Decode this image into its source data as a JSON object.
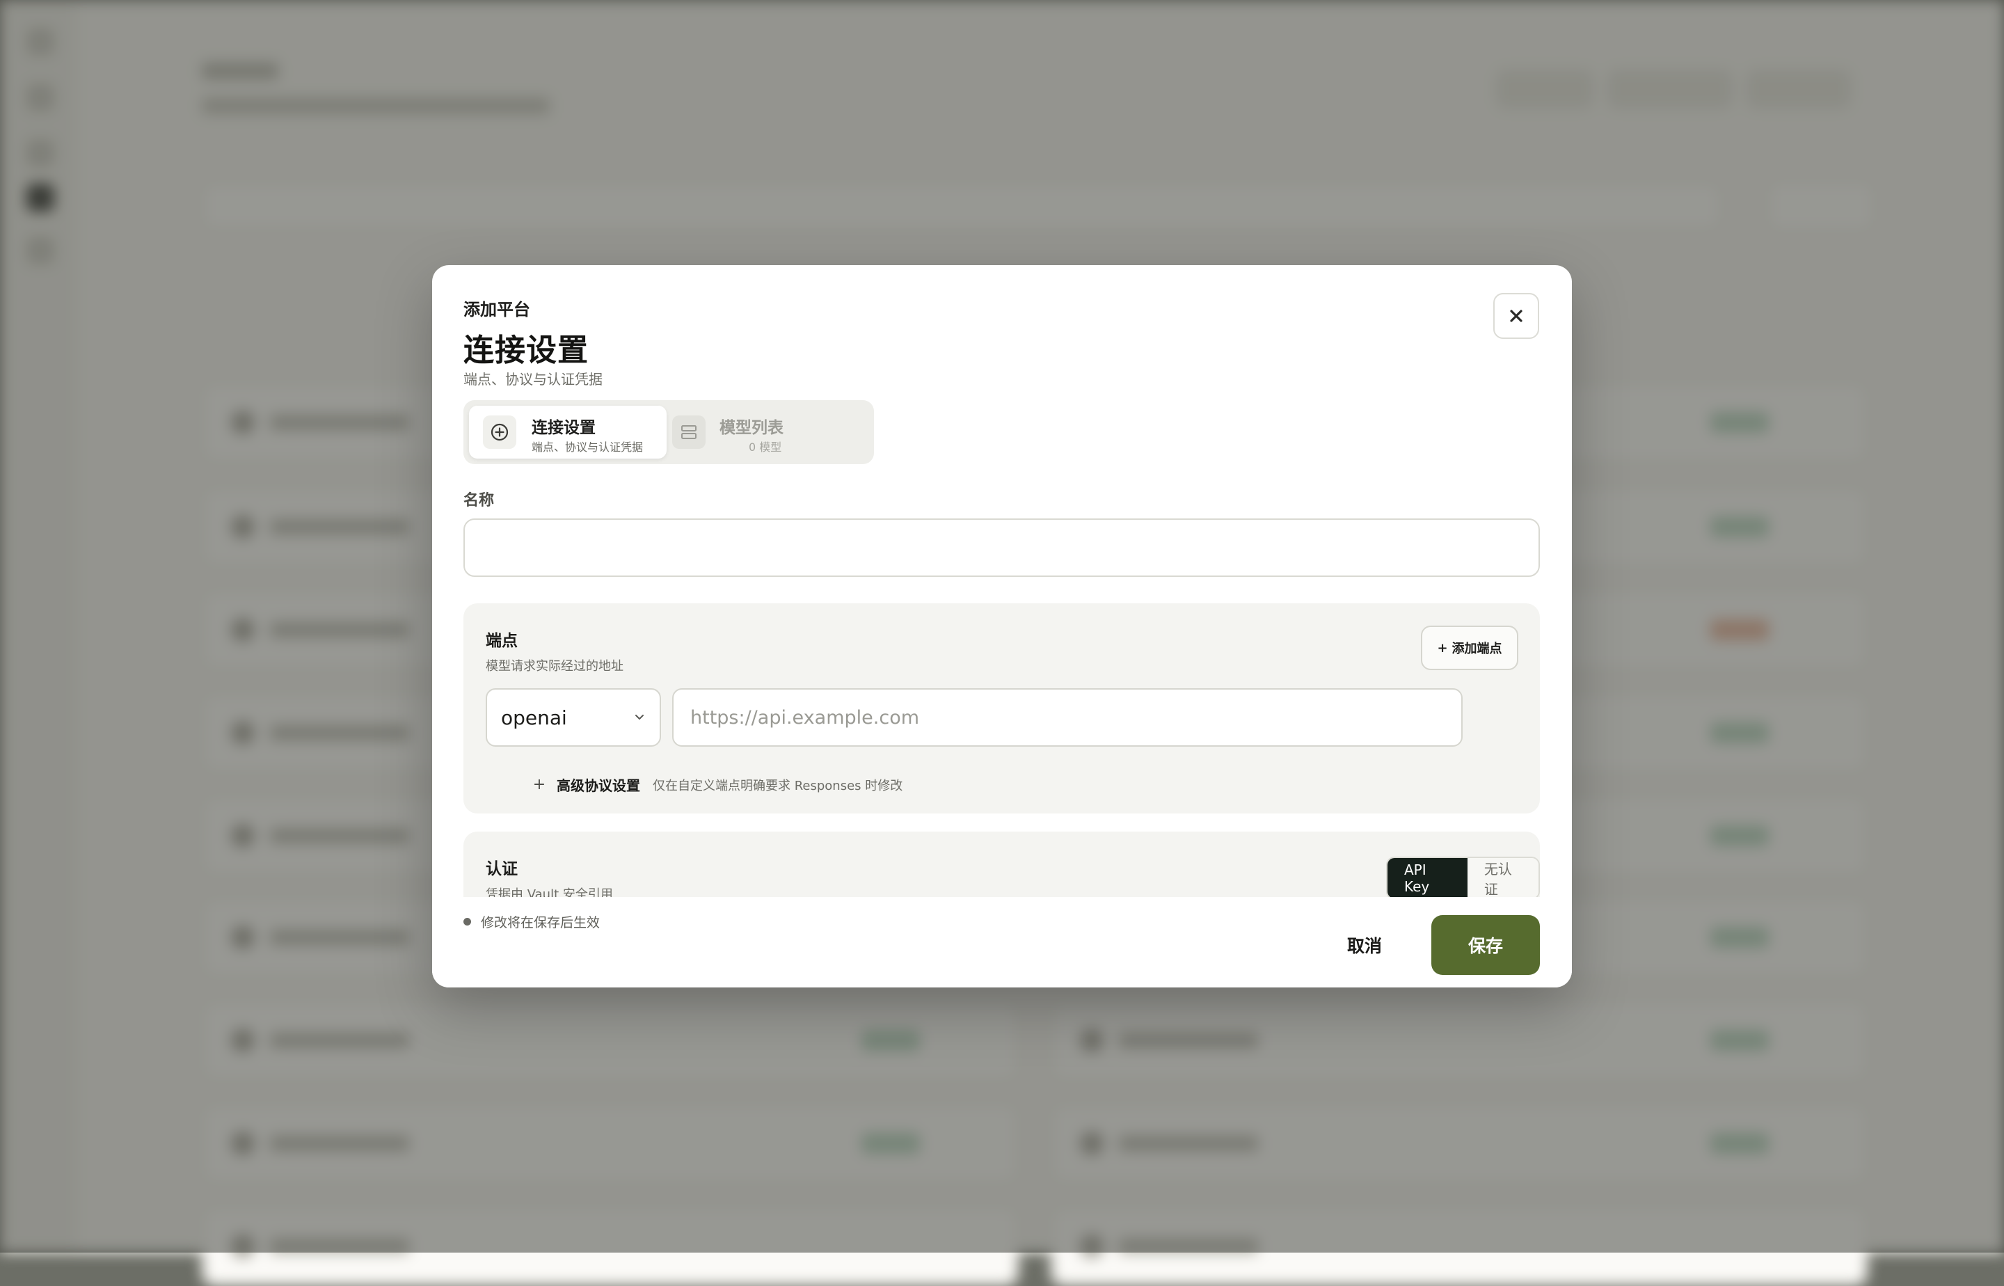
{
  "dialog": {
    "eyebrow": "添加平台",
    "title": "连接设置",
    "subtitle": "端点、协议与认证凭据",
    "close_icon": "close-icon"
  },
  "steps": [
    {
      "label": "连接设置",
      "sub": "端点、协议与认证凭据",
      "icon": "plus-circle-icon",
      "active": true
    },
    {
      "label": "模型列表",
      "sub": "0 模型",
      "icon": "list-icon",
      "active": false
    }
  ],
  "name_field": {
    "label": "名称",
    "value": "",
    "placeholder": ""
  },
  "endpoint": {
    "title": "端点",
    "description": "模型请求实际经过的地址",
    "add_label": "添加端点",
    "protocol": "openai",
    "url_placeholder": "https://api.example.com",
    "url_value": "",
    "advanced_label": "高级协议设置",
    "advanced_note": "仅在自定义端点明确要求 Responses 时修改"
  },
  "auth": {
    "title": "认证",
    "description": "凭据由 Vault 安全引用",
    "options": [
      "API Key",
      "无认证"
    ],
    "selected": "API Key"
  },
  "footer": {
    "note": "修改将在保存后生效",
    "cancel_label": "取消",
    "save_label": "保存"
  },
  "colors": {
    "primary": "#566b2e",
    "toggle_active": "#16201b",
    "overlay": "#6c6e66"
  }
}
